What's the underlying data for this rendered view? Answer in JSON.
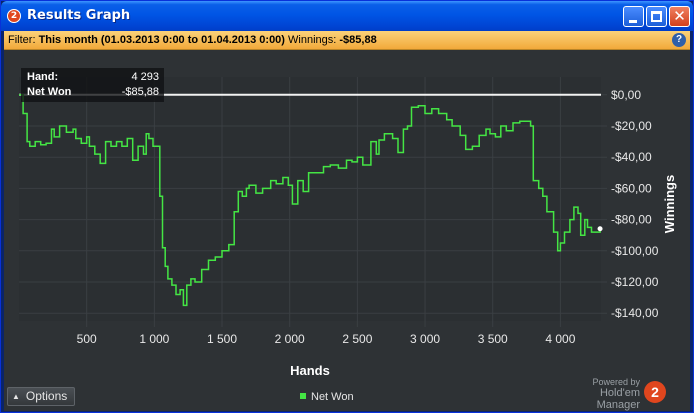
{
  "window": {
    "title": "Results Graph",
    "app_icon_label": "2"
  },
  "filter": {
    "label": "Filter:",
    "value": "This month (01.03.2013 0:00 to 01.04.2013 0:00)",
    "winnings_label": "Winnings:",
    "winnings_value": "-$85,88",
    "help_label": "?"
  },
  "tooltip": {
    "hand_label": "Hand:",
    "hand_value": "4 293",
    "net_label": "Net Won",
    "net_value": "-$85,88"
  },
  "options_label": "Options",
  "legend_label": "Net Won",
  "powered_by": "Powered by",
  "brand": "Hold'em Manager",
  "brand_badge": "2",
  "colors": {
    "series": "#44e544",
    "zero_line": "#f2f2f2",
    "background": "#2e3235",
    "filter_bar": "#f7c25a"
  },
  "chart_data": {
    "type": "line",
    "xlabel": "Hands",
    "ylabel": "Winnings",
    "xlim": [
      0,
      4300
    ],
    "ylim": [
      -145,
      5
    ],
    "x_ticks": [
      500,
      1000,
      1500,
      2000,
      2500,
      3000,
      3500,
      4000
    ],
    "x_tick_labels": [
      "500",
      "1 000",
      "1 500",
      "2 000",
      "2 500",
      "3 000",
      "3 500",
      "4 000"
    ],
    "y_ticks": [
      0,
      -20,
      -40,
      -60,
      -80,
      -100,
      -120,
      -140
    ],
    "y_tick_labels": [
      "$0,00",
      "-$20,00",
      "-$40,00",
      "-$60,00",
      "-$80,00",
      "-$100,00",
      "-$120,00",
      "-$140,00"
    ],
    "grid": true,
    "legend_position": "bottom-center",
    "zero_line": 0,
    "series": [
      {
        "name": "Net Won",
        "x": [
          0,
          30,
          60,
          80,
          120,
          160,
          200,
          240,
          260,
          300,
          350,
          400,
          420,
          460,
          500,
          520,
          560,
          600,
          640,
          680,
          720,
          760,
          800,
          840,
          880,
          920,
          940,
          960,
          990,
          1040,
          1060,
          1080,
          1100,
          1130,
          1160,
          1190,
          1215,
          1240,
          1270,
          1300,
          1350,
          1400,
          1450,
          1500,
          1550,
          1590,
          1620,
          1650,
          1680,
          1700,
          1750,
          1800,
          1860,
          1900,
          1950,
          1990,
          2020,
          2060,
          2100,
          2140,
          2200,
          2250,
          2300,
          2360,
          2420,
          2460,
          2500,
          2540,
          2600,
          2640,
          2660,
          2700,
          2760,
          2800,
          2840,
          2870,
          2900,
          2950,
          3000,
          3050,
          3100,
          3160,
          3200,
          3260,
          3300,
          3350,
          3400,
          3450,
          3480,
          3520,
          3560,
          3600,
          3650,
          3700,
          3750,
          3780,
          3800,
          3840,
          3870,
          3900,
          3950,
          3980,
          4000,
          4030,
          4070,
          4100,
          4130,
          4150,
          4180,
          4200,
          4230,
          4260,
          4293
        ],
        "y": [
          0,
          -12,
          -30,
          -33,
          -30,
          -32,
          -31,
          -22,
          -27,
          -20,
          -24,
          -22,
          -28,
          -31,
          -27,
          -33,
          -38,
          -44,
          -30,
          -33,
          -30,
          -33,
          -28,
          -42,
          -33,
          -38,
          -25,
          -28,
          -33,
          -65,
          -98,
          -110,
          -118,
          -122,
          -128,
          -125,
          -135,
          -122,
          -118,
          -120,
          -112,
          -106,
          -104,
          -100,
          -96,
          -75,
          -62,
          -65,
          -60,
          -58,
          -63,
          -60,
          -55,
          -57,
          -53,
          -58,
          -70,
          -55,
          -62,
          -50,
          -50,
          -46,
          -45,
          -47,
          -42,
          -43,
          -40,
          -45,
          -30,
          -38,
          -29,
          -25,
          -28,
          -37,
          -22,
          -20,
          -8,
          -7,
          -12,
          -9,
          -12,
          -16,
          -20,
          -26,
          -35,
          -33,
          -26,
          -22,
          -25,
          -27,
          -20,
          -23,
          -18,
          -17,
          -17,
          -20,
          -55,
          -60,
          -65,
          -75,
          -88,
          -100,
          -95,
          -88,
          -80,
          -72,
          -76,
          -90,
          -80,
          -85,
          -88,
          -88,
          -85.88
        ]
      }
    ]
  }
}
